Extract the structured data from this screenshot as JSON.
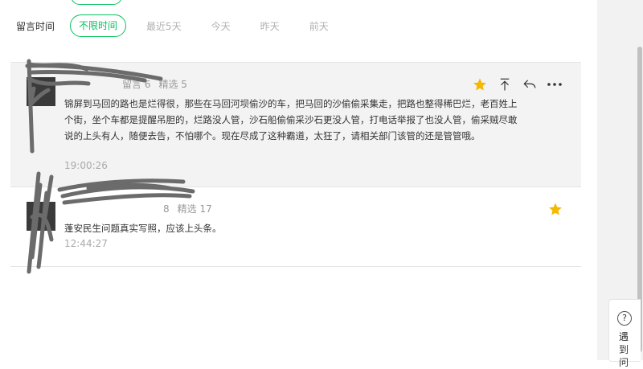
{
  "filter": {
    "label": "留言时间",
    "options": [
      "不限时间",
      "最近5天",
      "今天",
      "昨天",
      "前天"
    ],
    "active": "不限时间"
  },
  "comments": [
    {
      "nickname": "",
      "count_label": "留言 6",
      "featured_label": "精选 5",
      "content": "锦屏到马回的路也是烂得很，那些在马回河坝偷沙的车，把马回的沙偷偷采集走，把路也整得稀巴烂，老百姓上个街，坐个车都是提醒吊胆的，烂路没人管，沙石船偷偷采沙石更没人管，打电话举报了也没人管，偷采贼尽敢说的上头有人，随便去告，不怕哪个。现在尽成了这种霸道，太狂了，请相关部门该管的还是管管哦。",
      "time": "19:00:26",
      "starred": true
    },
    {
      "nickname": "",
      "count_label": "8",
      "featured_label": "精选 17",
      "content": "蓬安民生问题真实写照，应该上头条。",
      "time": "12:44:27",
      "starred": true
    }
  ],
  "help": {
    "icon": "?",
    "text": "遇到问"
  },
  "colors": {
    "accent": "#07c160",
    "star": "#f5b800"
  }
}
